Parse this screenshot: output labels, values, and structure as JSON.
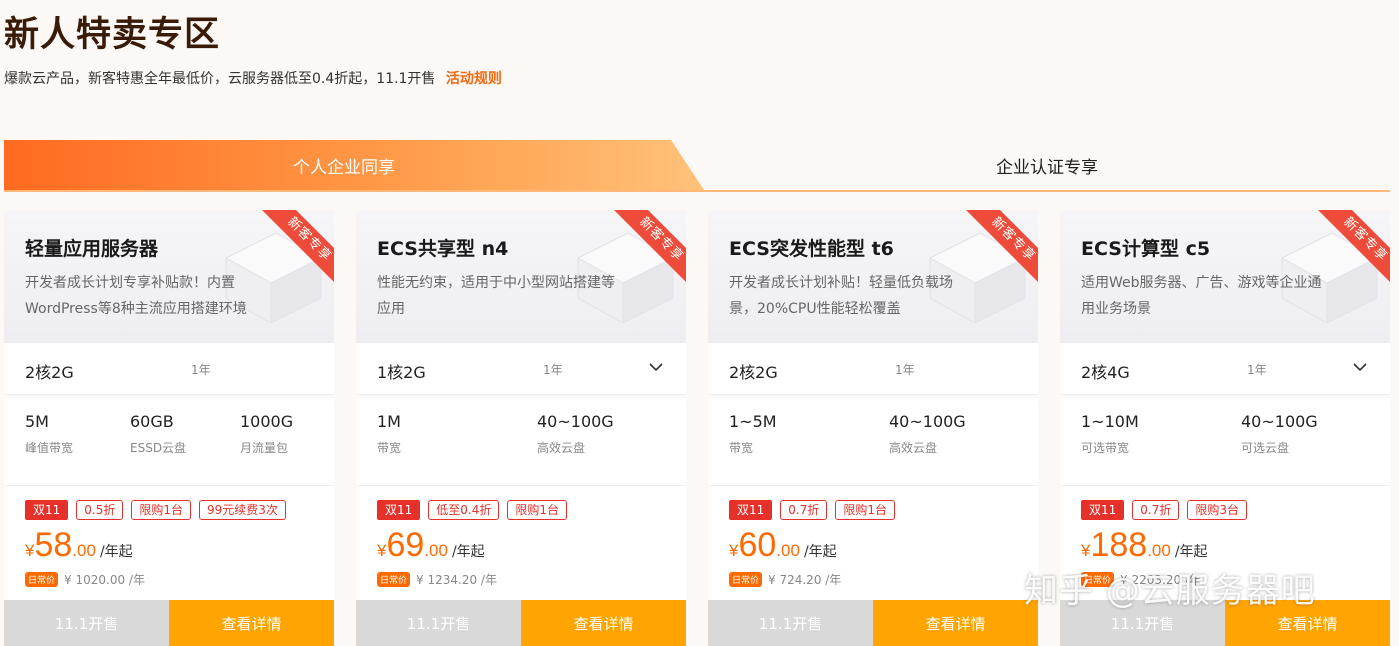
{
  "header": {
    "title": "新人特卖专区",
    "subtitle": "爆款云产品，新客特惠全年最低价，云服务器低至0.4折起，11.1开售",
    "rules_link": "活动规则"
  },
  "tabs": [
    {
      "label": "个人企业同享",
      "active": true
    },
    {
      "label": "企业认证专享",
      "active": false
    }
  ],
  "cards": [
    {
      "ribbon": "新客专享",
      "title": "轻量应用服务器",
      "desc": "开发者成长计划专享补贴款！内置WordPress等8种主流应用搭建环境",
      "spec": "2核2G",
      "duration": "1年",
      "has_dropdown": false,
      "features": [
        {
          "value": "5M",
          "label": "峰值带宽"
        },
        {
          "value": "60GB",
          "label": "ESSD云盘"
        },
        {
          "value": "1000G",
          "label": "月流量包"
        }
      ],
      "tags": [
        "双11",
        "0.5折",
        "限购1台",
        "99元续费3次"
      ],
      "price": {
        "yen": "¥",
        "int": "58",
        "dec": ".00",
        "unit": "/年起"
      },
      "normal_badge": "日常价",
      "normal_price": "¥ 1020.00 /年",
      "btn_sale": "11.1开售",
      "btn_detail": "查看详情"
    },
    {
      "ribbon": "新客专享",
      "title": "ECS共享型 n4",
      "desc": "性能无约束，适用于中小型网站搭建等应用",
      "spec": "1核2G",
      "duration": "1年",
      "has_dropdown": true,
      "features": [
        {
          "value": "1M",
          "label": "带宽"
        },
        {
          "value": "40~100G",
          "label": "高效云盘"
        }
      ],
      "tags": [
        "双11",
        "低至0.4折",
        "限购1台"
      ],
      "price": {
        "yen": "¥",
        "int": "69",
        "dec": ".00",
        "unit": "/年起"
      },
      "normal_badge": "日常价",
      "normal_price": "¥ 1234.20 /年",
      "btn_sale": "11.1开售",
      "btn_detail": "查看详情"
    },
    {
      "ribbon": "新客专享",
      "title": "ECS突发性能型 t6",
      "desc": "开发者成长计划补贴！轻量低负载场景，20%CPU性能轻松覆盖",
      "spec": "2核2G",
      "duration": "1年",
      "has_dropdown": false,
      "features": [
        {
          "value": "1~5M",
          "label": "带宽"
        },
        {
          "value": "40~100G",
          "label": "高效云盘"
        }
      ],
      "tags": [
        "双11",
        "0.7折",
        "限购1台"
      ],
      "price": {
        "yen": "¥",
        "int": "60",
        "dec": ".00",
        "unit": "/年起"
      },
      "normal_badge": "日常价",
      "normal_price": "¥ 724.20 /年",
      "btn_sale": "11.1开售",
      "btn_detail": "查看详情"
    },
    {
      "ribbon": "新客专享",
      "title": "ECS计算型 c5",
      "desc": "适用Web服务器、广告、游戏等企业通用业务场景",
      "spec": "2核4G",
      "duration": "1年",
      "has_dropdown": true,
      "features": [
        {
          "value": "1~10M",
          "label": "可选带宽"
        },
        {
          "value": "40~100G",
          "label": "可选云盘"
        }
      ],
      "tags": [
        "双11",
        "0.7折",
        "限购3台"
      ],
      "price": {
        "yen": "¥",
        "int": "188",
        "dec": ".00",
        "unit": "/年起"
      },
      "normal_badge": "日常价",
      "normal_price": "¥ 2203.20 /年",
      "btn_sale": "11.1开售",
      "btn_detail": "查看详情"
    }
  ],
  "watermark": "知乎 @云服务器吧",
  "colors": {
    "accent": "#ff6a00",
    "tag_red": "#e5312a",
    "detail_button": "#ffa400",
    "sale_button": "#d9d9d9"
  }
}
